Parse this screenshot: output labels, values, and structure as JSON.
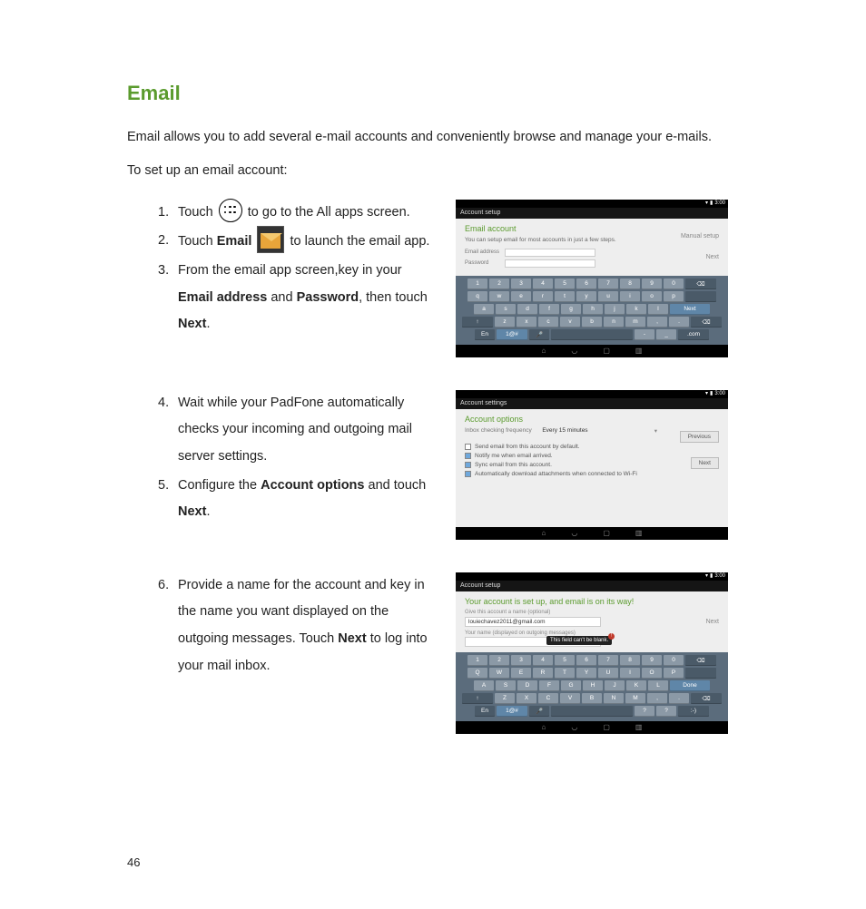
{
  "page_number": "46",
  "title": "Email",
  "intro": "Email allows you to add several e-mail accounts and conveniently browse and manage your e-mails.",
  "setup_line": "To set up an email account:",
  "steps": {
    "s1_a": "Touch ",
    "s1_b": " to go to the All apps screen.",
    "s2_a": "Touch ",
    "s2_bold": "Email",
    "s2_b": " to launch the email app.",
    "s3_a": "From the email app screen,key in your ",
    "s3_bold1": "Email address",
    "s3_mid": " and ",
    "s3_bold2": "Password",
    "s3_b": ", then  touch ",
    "s3_bold3": "Next",
    "s3_end": ".",
    "s4": "Wait while your PadFone automatically checks your incoming and outgoing mail server settings.",
    "s5_a": "Configure the ",
    "s5_bold1": "Account options",
    "s5_b": " and touch ",
    "s5_bold2": "Next",
    "s5_end": ".",
    "s6_a": "Provide a name for the account and key in the name you want displayed on the outgoing messages. Touch ",
    "s6_bold": "Next",
    "s6_b": " to log into your mail inbox."
  },
  "shot1": {
    "app_title": "Account setup",
    "panel_title": "Email account",
    "panel_sub": "You can setup email for most accounts in just a few steps.",
    "label_email": "Email address",
    "label_password": "Password",
    "btn_manual": "Manual setup",
    "btn_next": "Next",
    "status_time": "3:00",
    "kb": {
      "row1": [
        "1",
        "2",
        "3",
        "4",
        "5",
        "6",
        "7",
        "8",
        "9",
        "0"
      ],
      "row2": [
        "q",
        "w",
        "e",
        "r",
        "t",
        "y",
        "u",
        "i",
        "o",
        "p"
      ],
      "row3": [
        "a",
        "s",
        "d",
        "f",
        "g",
        "h",
        "j",
        "k",
        "l"
      ],
      "row3_side": "Next",
      "row4_left": "↑",
      "row4": [
        "z",
        "x",
        "c",
        "v",
        "b",
        "n",
        "m",
        ",",
        "."
      ],
      "row4_right": "⌫",
      "row5": [
        "En",
        "1@#",
        "🎤",
        "",
        "-",
        "_",
        ".com"
      ]
    }
  },
  "shot2": {
    "app_title": "Account settings",
    "panel_title": "Account options",
    "freq_label": "Inbox checking frequency",
    "freq_value": "Every 15 minutes",
    "btn_prev": "Previous",
    "btn_next": "Next",
    "opt1": "Send email from this account by default.",
    "opt2": "Notify me when email arrived.",
    "opt3": "Sync email from this account.",
    "opt4": "Automatically download attachments when connected to Wi-Fi",
    "status_time": "3:00"
  },
  "shot3": {
    "app_title": "Account setup",
    "panel_title": "Your account is set up, and email is on its way!",
    "label1": "Give this account a name (optional)",
    "value1": "louiechavez2011@gmail.com",
    "label2": "Your name (displayed on outgoing messages)",
    "btn_next": "Next",
    "tooltip": "This field can't be blank.",
    "status_time": "3:00",
    "kb": {
      "row1": [
        "1",
        "2",
        "3",
        "4",
        "5",
        "6",
        "7",
        "8",
        "9",
        "0"
      ],
      "row2": [
        "Q",
        "W",
        "E",
        "R",
        "T",
        "Y",
        "U",
        "I",
        "O",
        "P"
      ],
      "row3": [
        "A",
        "S",
        "D",
        "F",
        "G",
        "H",
        "J",
        "K",
        "L"
      ],
      "row3_side": "Done",
      "row4_left": "↑",
      "row4": [
        "Z",
        "X",
        "C",
        "V",
        "B",
        "N",
        "M",
        ",",
        "."
      ],
      "row4_right": "⌫",
      "row5": [
        "En",
        "1@#",
        "🎤",
        "",
        "?",
        "?",
        ":-)"
      ]
    }
  },
  "nav_icons": [
    "⌂",
    "◁",
    "▢",
    "▢▢"
  ]
}
